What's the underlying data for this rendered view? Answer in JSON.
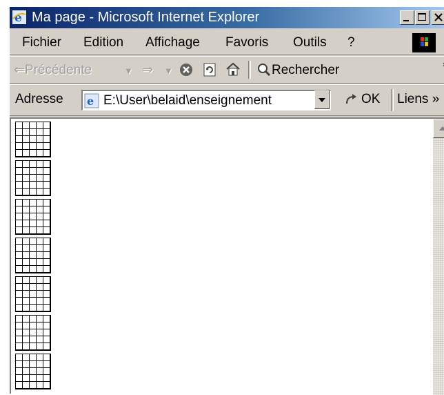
{
  "window": {
    "title": "Ma page - Microsoft Internet Explorer",
    "title_gradient": [
      "#0a246a",
      "#a6caf0"
    ]
  },
  "menu": {
    "items": [
      "Fichier",
      "Edition",
      "Affichage",
      "Favoris",
      "Outils",
      "?"
    ]
  },
  "toolbar": {
    "back_label": "Précédente",
    "search_label": "Rechercher",
    "icons": [
      "back-arrow-icon",
      "forward-arrow-icon",
      "stop-icon",
      "refresh-icon",
      "home-icon",
      "search-icon"
    ]
  },
  "address": {
    "label": "Adresse",
    "value": "E:\\User\\belaid\\enseignement",
    "go_label": "OK",
    "links_label": "Liens"
  },
  "content": {
    "grid_count": 7,
    "grid_rows": 5,
    "grid_cols": 5
  }
}
